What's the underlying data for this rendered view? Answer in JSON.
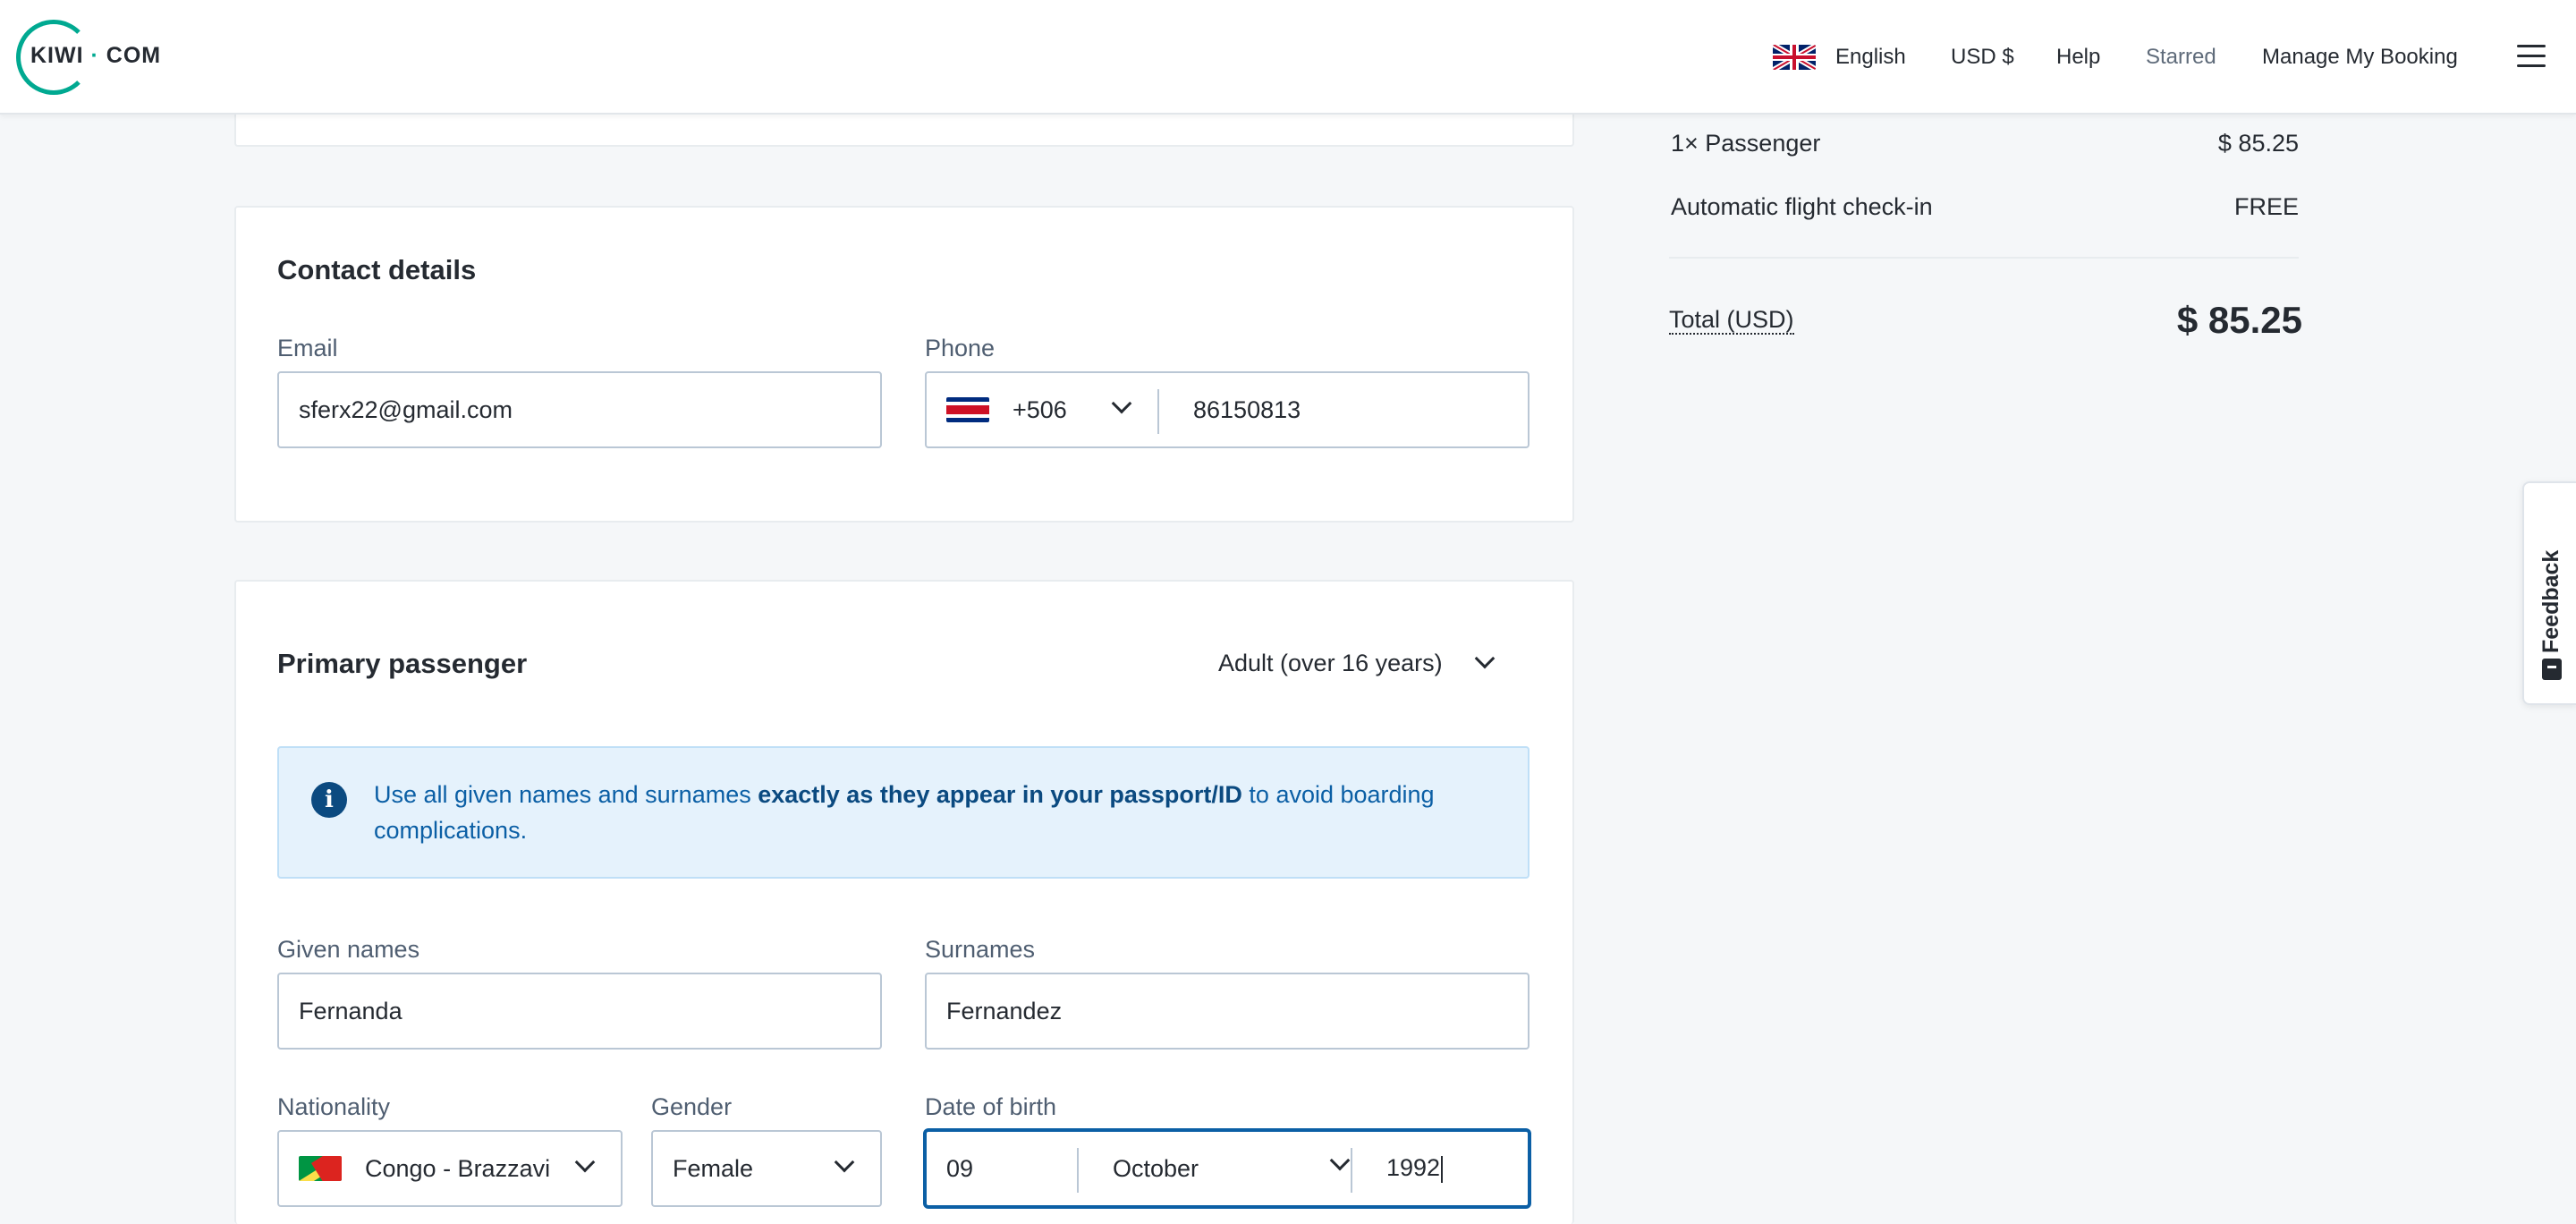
{
  "header": {
    "logo_text_left": "KIWI",
    "logo_dot": "·",
    "logo_text_right": "COM",
    "language": "English",
    "currency": "USD $",
    "help": "Help",
    "starred": "Starred",
    "manage_booking": "Manage My Booking",
    "menu_icon": "hamburger-icon",
    "language_flag_icon": "uk-flag-icon"
  },
  "contact": {
    "title": "Contact details",
    "email_label": "Email",
    "email_value": "sferx22@gmail.com",
    "phone_label": "Phone",
    "phone_country_code": "+506",
    "phone_country_flag": "costa-rica-flag-icon",
    "phone_number": "86150813"
  },
  "passenger": {
    "title": "Primary passenger",
    "type_select": "Adult (over 16 years)",
    "info_text_before": "Use all given names and surnames ",
    "info_text_bold": "exactly as they appear in your passport/ID",
    "info_text_after": " to avoid boarding complications.",
    "given_names_label": "Given names",
    "given_names_value": "Fernanda",
    "surnames_label": "Surnames",
    "surnames_value": "Fernandez",
    "nationality_label": "Nationality",
    "nationality_value": "Congo - Brazzavi",
    "nationality_flag": "congo-flag-icon",
    "gender_label": "Gender",
    "gender_value": "Female",
    "dob_label": "Date of birth",
    "dob_day": "09",
    "dob_month": "October",
    "dob_year": "1992"
  },
  "summary": {
    "passenger_row_label": "1× Passenger",
    "passenger_row_price": "$ 85.25",
    "checkin_row_label": "Automatic flight check-in",
    "checkin_row_price": "FREE",
    "total_label": "Total (USD)",
    "total_value": "$ 85.25"
  },
  "feedback": {
    "label": "Feedback"
  },
  "colors": {
    "brand": "#00a991",
    "info_bg": "#e5f2fc",
    "info_text": "#0b5fa5",
    "focus_border": "#0b5fa5"
  }
}
